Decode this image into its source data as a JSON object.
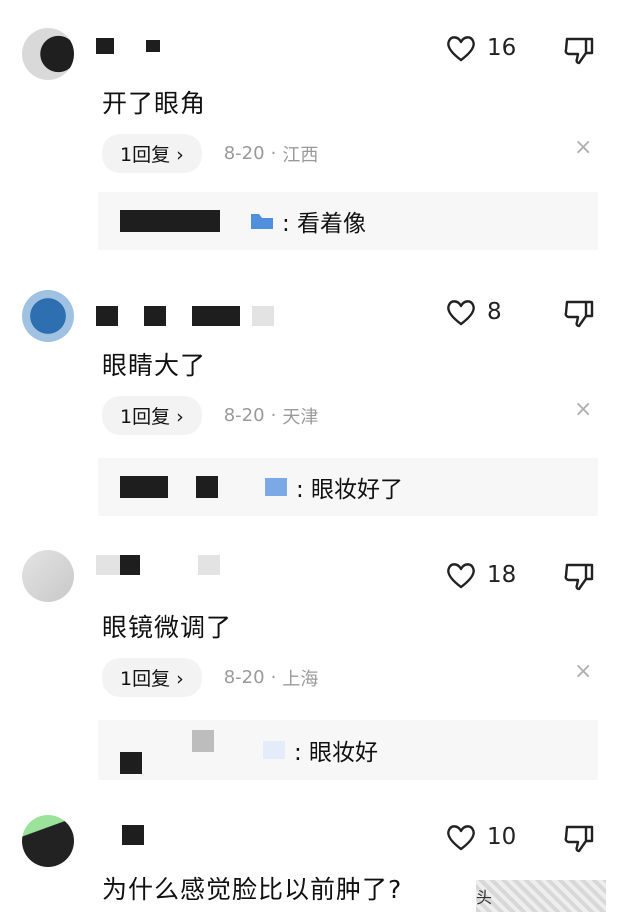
{
  "comments": [
    {
      "content": "开了眼角",
      "likes": "16",
      "reply_label": "1回复 ›",
      "date": "8-20",
      "location": "江西",
      "close": "×",
      "sub_reply": ": 看着像"
    },
    {
      "content": "眼睛大了",
      "likes": "8",
      "reply_label": "1回复 ›",
      "date": "8-20",
      "location": "天津",
      "close": "×",
      "sub_reply": ": 眼妆好了"
    },
    {
      "content": "眼镜微调了",
      "likes": "18",
      "reply_label": "1回复 ›",
      "date": "8-20",
      "location": "上海",
      "close": "×",
      "sub_reply": ": 眼妆好"
    },
    {
      "content": "为什么感觉脸比以前肿了?",
      "likes": "10"
    }
  ],
  "separator": "·",
  "watermark": "头"
}
